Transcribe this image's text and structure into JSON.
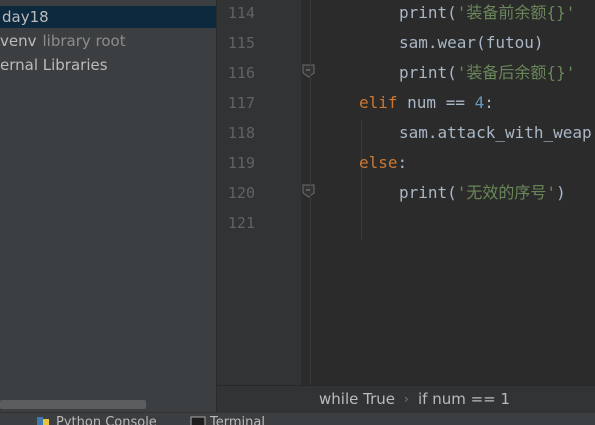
{
  "sidebar": {
    "items": [
      {
        "label": "day18",
        "selected": true
      },
      {
        "label": "venv",
        "suffix": "library root"
      },
      {
        "label": "ernal Libraries"
      }
    ]
  },
  "editor": {
    "line_numbers": [
      "114",
      "115",
      "116",
      "117",
      "118",
      "119",
      "120",
      "121"
    ],
    "lines": {
      "l114_fn": "print(",
      "l114_str": "'装备前余额{}'",
      "l115": "sam.wear(futou)",
      "l116_fn": "print(",
      "l116_str": "'装备后余额{}'",
      "l117_kw": "elif",
      "l117_rest": " num == ",
      "l117_num": "4",
      "l117_colon": ":",
      "l118": "sam.attack_with_weap",
      "l119_kw": "else",
      "l119_colon": ":",
      "l120_fn": "print(",
      "l120_str": "'无效的序号'",
      "l120_close": ")"
    }
  },
  "breadcrumb": {
    "items": [
      "while True",
      "if num == 1"
    ],
    "separator": "›"
  },
  "bottom_bar": {
    "tabs": [
      "Python Console",
      "Terminal"
    ]
  },
  "colors": {
    "keyword": "#cc7832",
    "string": "#6a8759",
    "number": "#6897bb",
    "text": "#a9b7c6",
    "selection": "#0d293e"
  }
}
